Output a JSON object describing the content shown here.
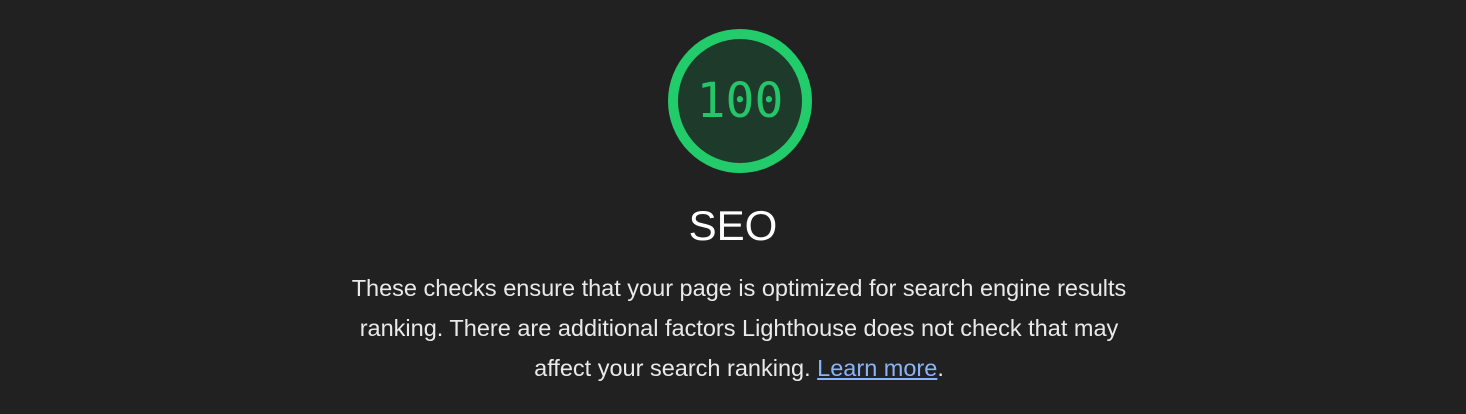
{
  "gauge": {
    "score": "100",
    "color": "#0cce6b",
    "fill": "#1f3a2b"
  },
  "category": {
    "title": "SEO",
    "description": "These checks ensure that your page is optimized for search engine results ranking. There are additional factors Lighthouse does not check that may affect your search ranking. ",
    "learn_more": "Learn more",
    "trailing": "."
  }
}
